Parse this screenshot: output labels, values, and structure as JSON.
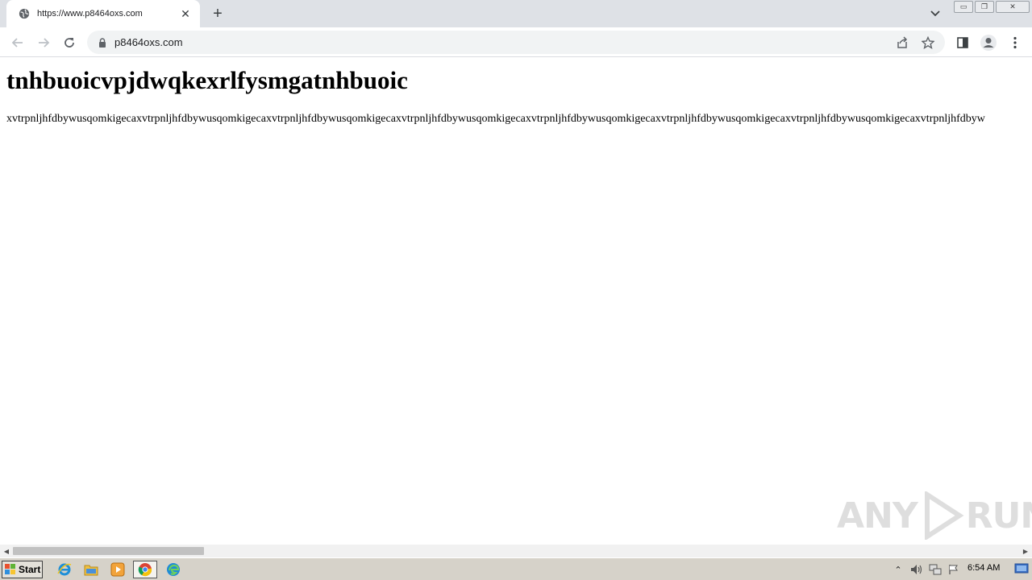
{
  "browser": {
    "tab": {
      "title": "https://www.p8464oxs.com",
      "close_glyph": "✕"
    },
    "new_tab_glyph": "+",
    "address_bar": {
      "url": "p8464oxs.com"
    },
    "window_controls": {
      "minimize": "▭",
      "restore": "❐",
      "close": "✕"
    }
  },
  "page": {
    "heading": "tnhbuoicvpjdwqkexrlfysmgatnhbuoic",
    "paragraph": "xvtrpnljhfdbywusqomkigecaxvtrpnljhfdbywusqomkigecaxvtrpnljhfdbywusqomkigecaxvtrpnljhfdbywusqomkigecaxvtrpnljhfdbywusqomkigecaxvtrpnljhfdbywusqomkigecaxvtrpnljhfdbywusqomkigecaxvtrpnljhfdbyw"
  },
  "watermark": {
    "text_left": "ANY",
    "text_right": "RUN"
  },
  "taskbar": {
    "start_label": "Start",
    "clock": "6:54 AM"
  },
  "colors": {
    "tabstrip_bg": "#dee1e6",
    "toolbar_bg": "#ffffff",
    "omnibox_bg": "#f1f3f4",
    "taskbar_bg": "#d6d2c9"
  },
  "icons": {
    "favicon": "globe-icon",
    "back": "arrow-left-icon",
    "forward": "arrow-right-icon",
    "reload": "reload-icon",
    "lock": "lock-icon",
    "share": "share-icon",
    "bookmark": "star-icon",
    "side_panel": "side-panel-icon",
    "profile": "profile-icon",
    "menu": "kebab-menu-icon"
  }
}
